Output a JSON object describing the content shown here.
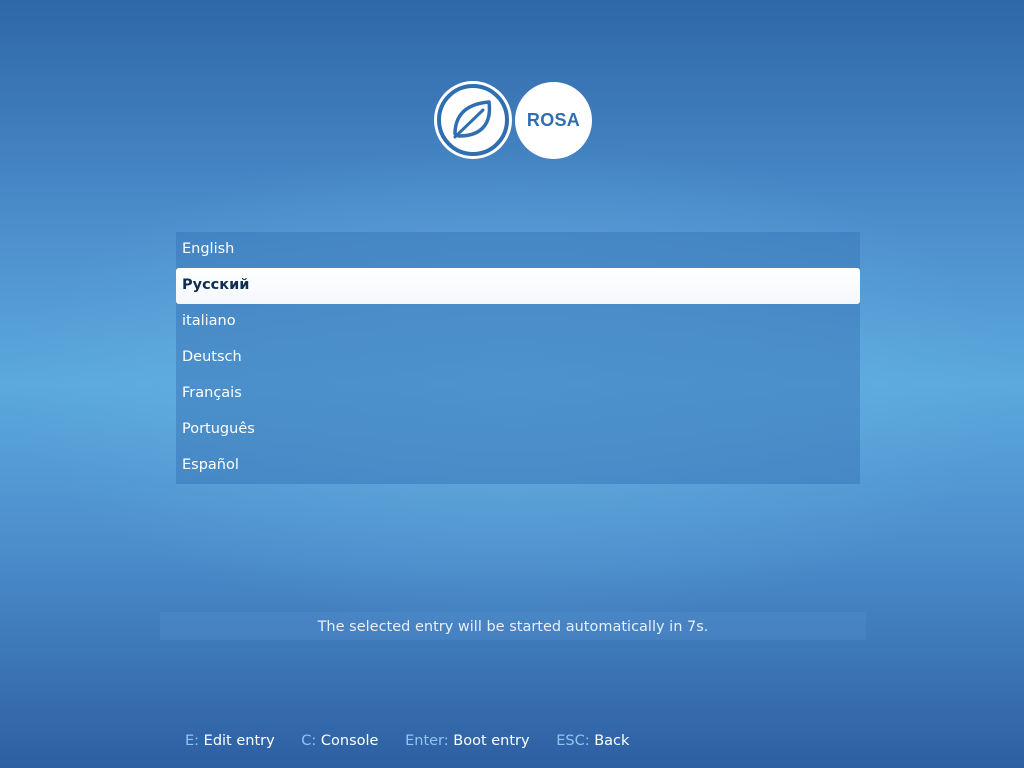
{
  "logo": {
    "brand_text": "ROSA",
    "icon": "leaf-icon"
  },
  "menu": {
    "items": [
      {
        "label": "English",
        "selected": false
      },
      {
        "label": "Русский",
        "selected": true
      },
      {
        "label": "italiano",
        "selected": false
      },
      {
        "label": "Deutsch",
        "selected": false
      },
      {
        "label": "Français",
        "selected": false
      },
      {
        "label": "Português",
        "selected": false
      },
      {
        "label": "Español",
        "selected": false
      }
    ]
  },
  "timeout_message": "The selected entry will be started automatically in 7s.",
  "hints": [
    {
      "key": "E:",
      "label": "Edit entry"
    },
    {
      "key": "C:",
      "label": "Console"
    },
    {
      "key": "Enter:",
      "label": "Boot entry"
    },
    {
      "key": "ESC:",
      "label": "Back"
    }
  ],
  "colors": {
    "hint_key": "#8fc6f2",
    "selected_text": "#0f2d52",
    "logo_blue": "#2f6fb1"
  }
}
